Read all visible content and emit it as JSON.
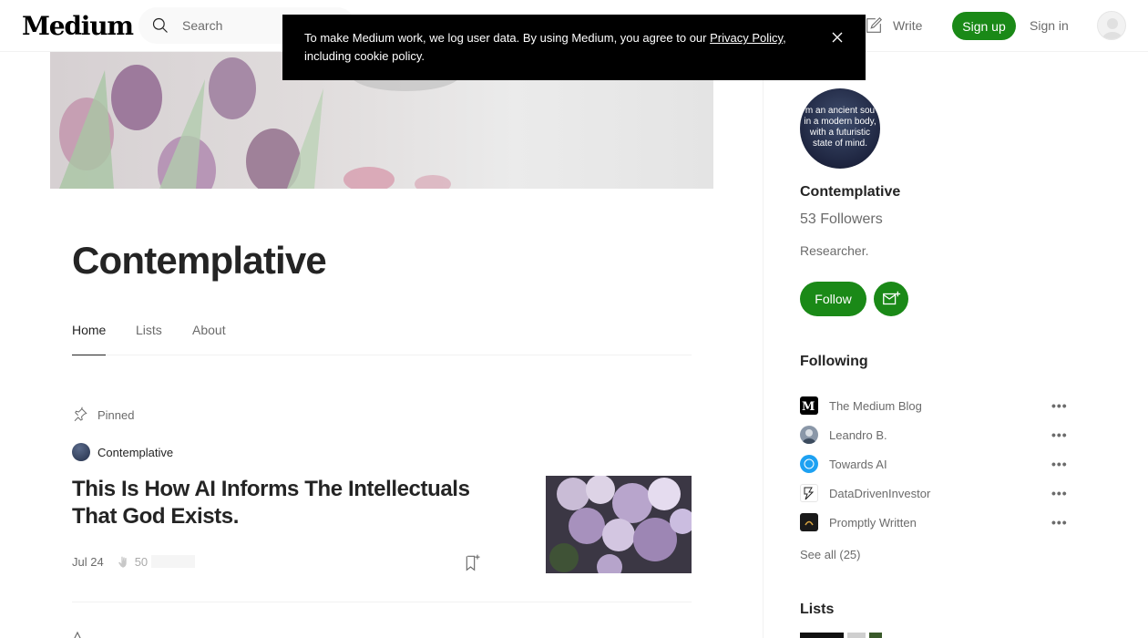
{
  "header": {
    "logo": "Medium",
    "search_placeholder": "Search",
    "write_label": "Write",
    "signup_label": "Sign up",
    "signin_label": "Sign in"
  },
  "cookie": {
    "text_before": "To make Medium work, we log user data. By using Medium, you agree to our ",
    "link": "Privacy Policy",
    "text_after": ", including cookie policy."
  },
  "profile": {
    "title": "Contemplative",
    "tabs": [
      "Home",
      "Lists",
      "About"
    ],
    "active_tab": "Home"
  },
  "article": {
    "pinned_label": "Pinned",
    "publication": "Contemplative",
    "title": "This Is How AI Informs The Intellectuals That God Exists.",
    "date": "Jul 24",
    "claps": "50"
  },
  "sidebar": {
    "avatar_text": "I'm an ancient soul in a modern body, with a futuristic state of mind.",
    "name": "Contemplative",
    "followers": "53 Followers",
    "bio": "Researcher.",
    "follow_label": "Follow",
    "following_heading": "Following",
    "following": [
      {
        "name": "The Medium Blog",
        "icon": "medium-blog-icon",
        "color": "#000000"
      },
      {
        "name": "Leandro B.",
        "icon": "leandro-avatar",
        "color": "#8a97a8"
      },
      {
        "name": "Towards AI",
        "icon": "towards-ai-icon",
        "color": "#1da1f2"
      },
      {
        "name": "DataDrivenInvestor",
        "icon": "ddi-icon",
        "color": "#ffffff"
      },
      {
        "name": "Promptly Written",
        "icon": "promptly-written-icon",
        "color": "#1a1a1a"
      }
    ],
    "more_label": "•••",
    "see_all": "See all (25)",
    "lists_heading": "Lists"
  },
  "colors": {
    "accent": "#1a8917",
    "text": "#242424",
    "muted": "#6b6b6b"
  }
}
